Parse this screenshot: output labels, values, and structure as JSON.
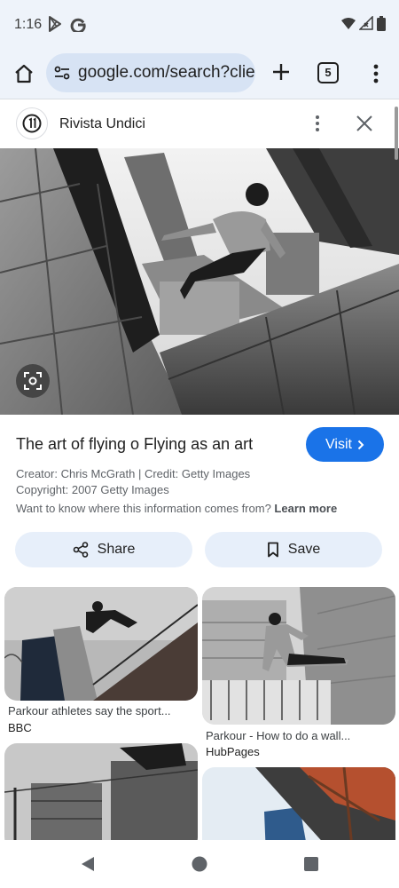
{
  "status_bar": {
    "time": "1:16"
  },
  "browser": {
    "url": "google.com/search?clier",
    "tab_count": "5"
  },
  "source": {
    "name": "Rivista Undici"
  },
  "detail": {
    "title": "The art of flying o Flying as an art",
    "visit_label": "Visit",
    "creator_line": "Creator: Chris McGrath | Credit: Getty Images",
    "copyright_line": "Copyright: 2007 Getty Images",
    "info_question": "Want to know where this information comes from?",
    "learn_more": "Learn more",
    "share_label": "Share",
    "save_label": "Save"
  },
  "results": [
    {
      "title": "Parkour athletes say the sport...",
      "source": "BBC"
    },
    {
      "title": "Parkour - How to do a wall...",
      "source": "HubPages"
    }
  ],
  "icons": {
    "home": "home-icon",
    "site_info": "tune-icon",
    "new_tab": "plus-icon",
    "menu": "more-vert-icon",
    "close": "close-icon",
    "lens": "lens-icon",
    "share": "share-icon",
    "save": "bookmark-icon",
    "back": "back-triangle-icon",
    "home_nav": "home-circle-icon",
    "recents": "recents-square-icon"
  },
  "colors": {
    "chrome_bg": "#eef3fa",
    "omnibox_bg": "#d7e3f4",
    "accent": "#1a73e8",
    "action_bg": "#e7effa"
  }
}
